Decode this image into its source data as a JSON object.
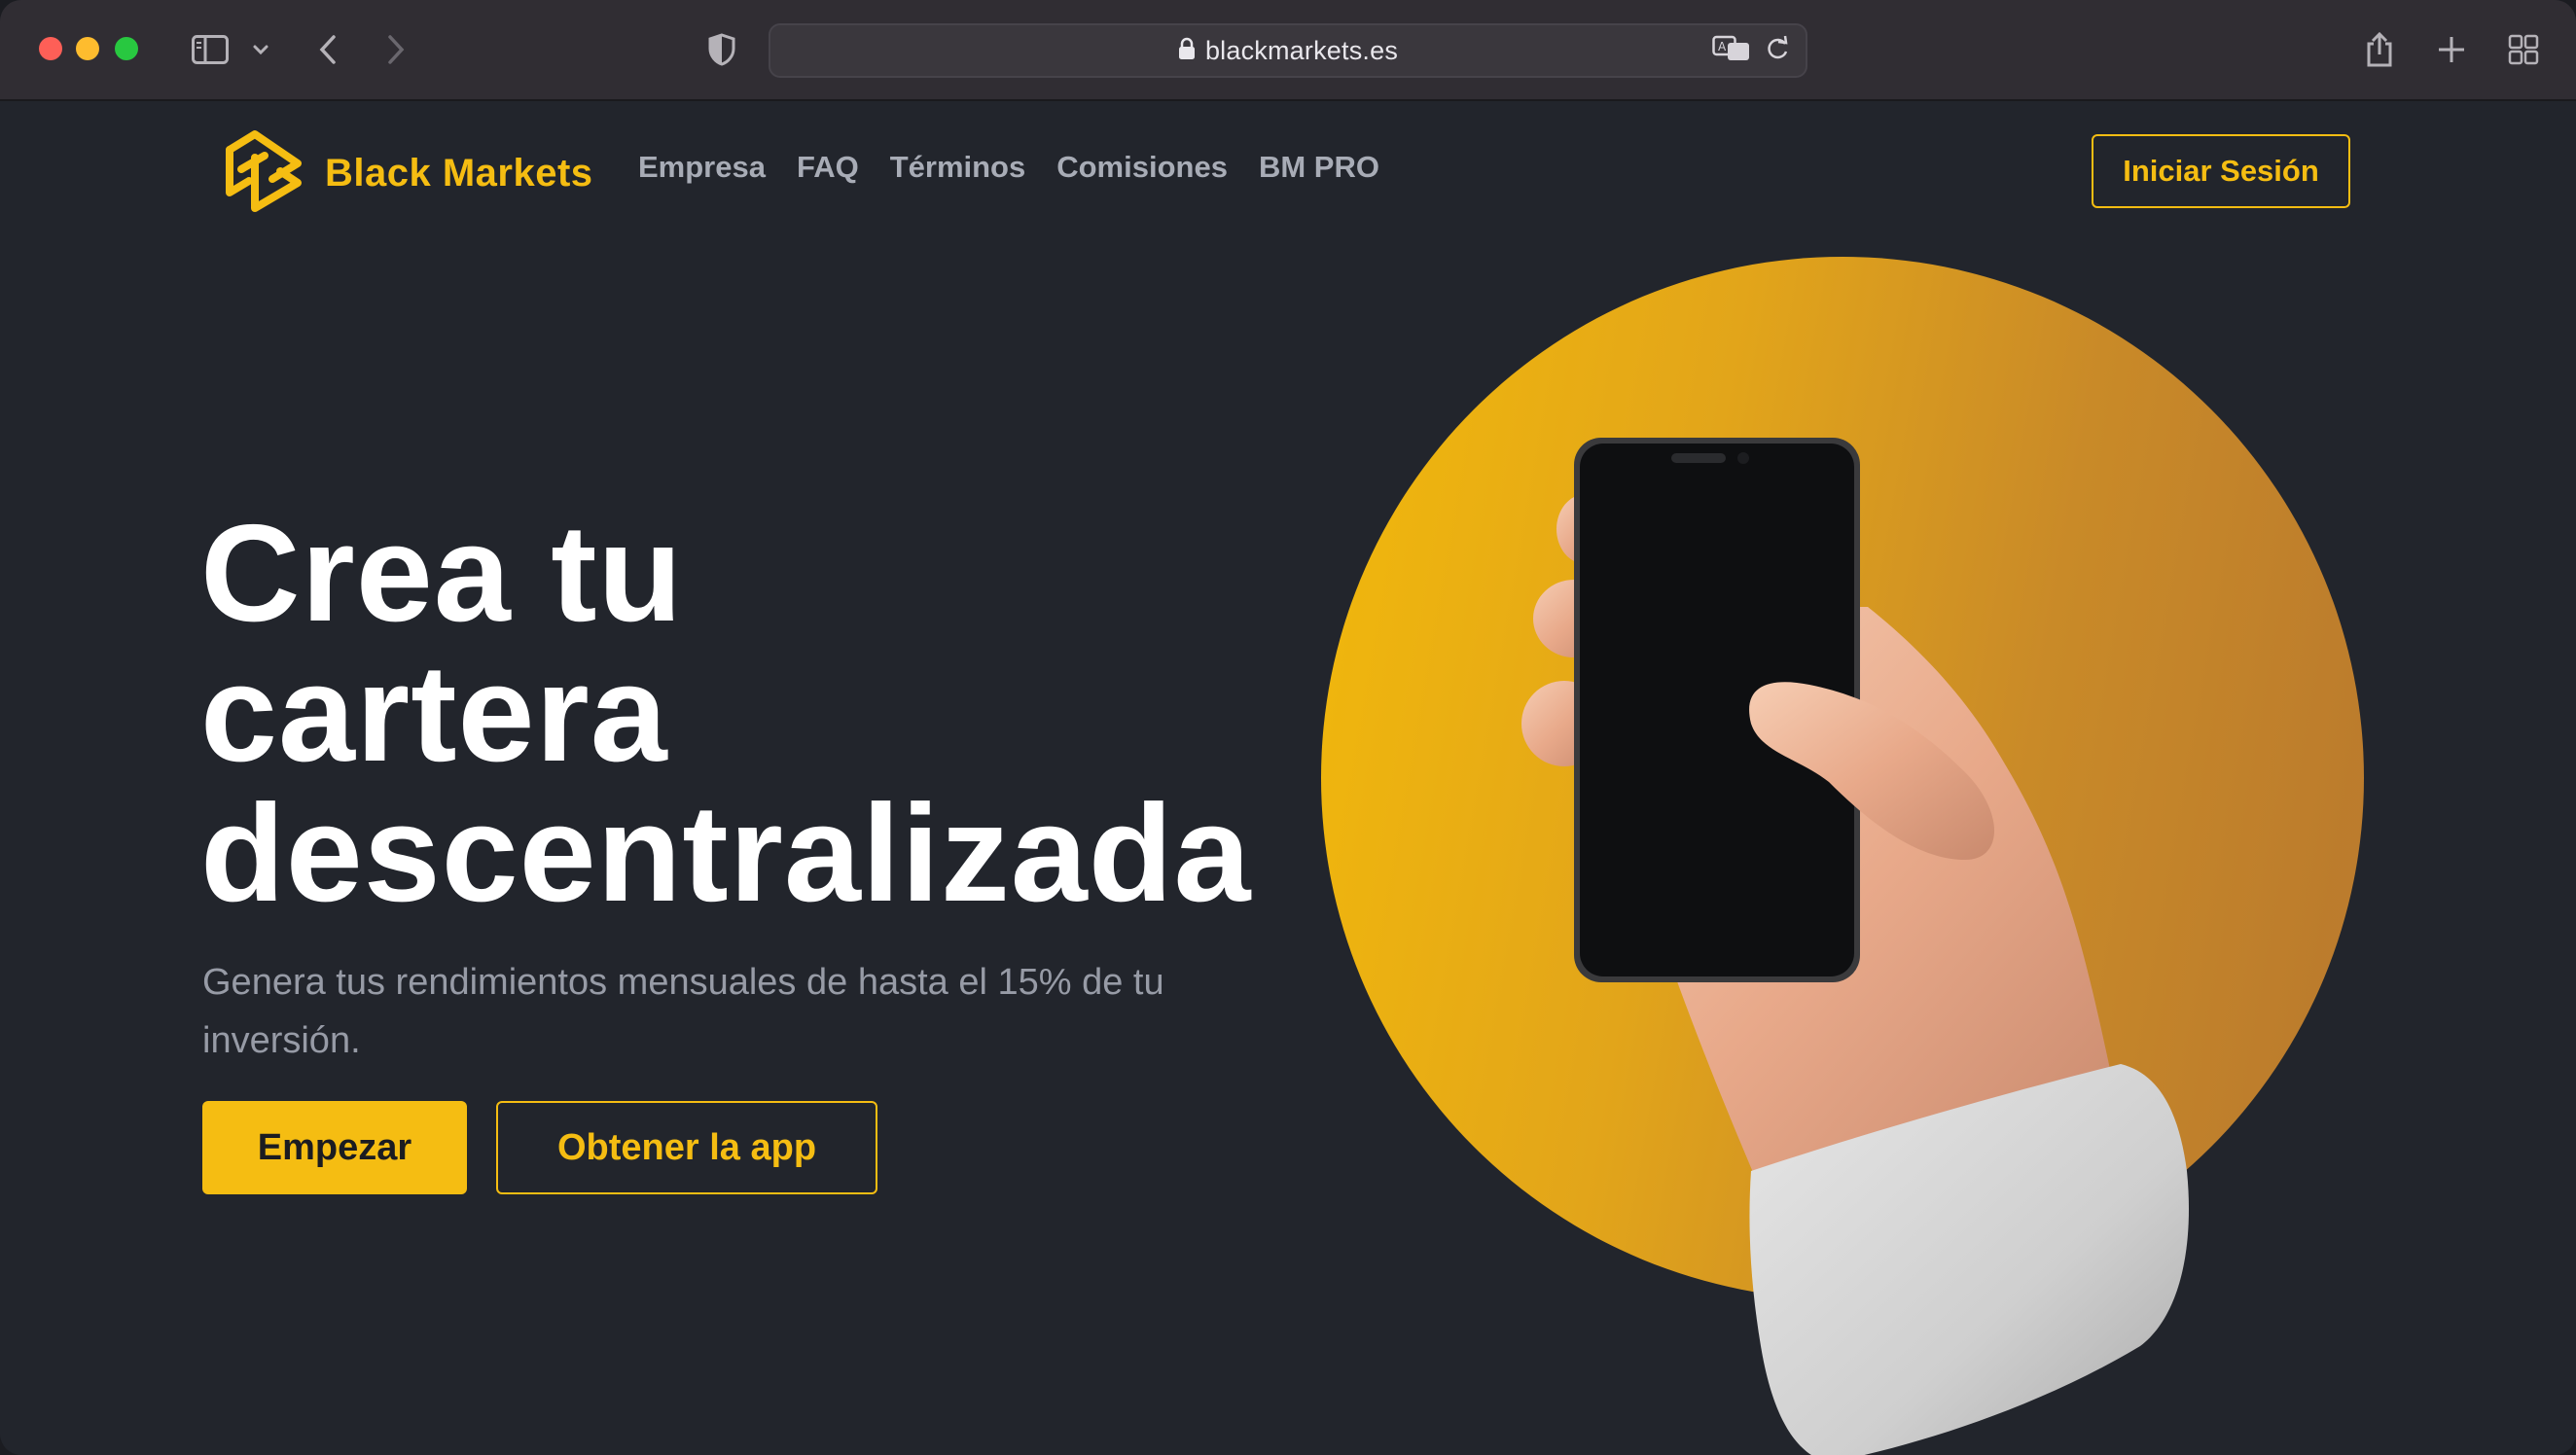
{
  "browser": {
    "url": "blackmarkets.es"
  },
  "nav": {
    "brand": "Black Markets",
    "links": [
      "Empresa",
      "FAQ",
      "Términos",
      "Comisiones",
      "BM PRO"
    ],
    "login": "Iniciar Sesión"
  },
  "hero": {
    "title_line1": "Crea tu",
    "title_line2": "cartera",
    "title_line3": "descentralizada",
    "subtitle": "Genera tus rendimientos mensuales de hasta el 15% de tu inversión.",
    "primary_button": "Empezar",
    "secondary_button": "Obtener la app"
  },
  "colors": {
    "accent": "#f5bd12",
    "background": "#22252c",
    "muted_text": "#979ba6"
  },
  "icons": {
    "chrome": [
      "sidebar-icon",
      "chevron-down-icon",
      "back-icon",
      "forward-icon",
      "shield-icon",
      "lock-icon",
      "translate-icon",
      "reload-icon",
      "share-icon",
      "new-tab-icon",
      "tab-overview-icon"
    ]
  }
}
